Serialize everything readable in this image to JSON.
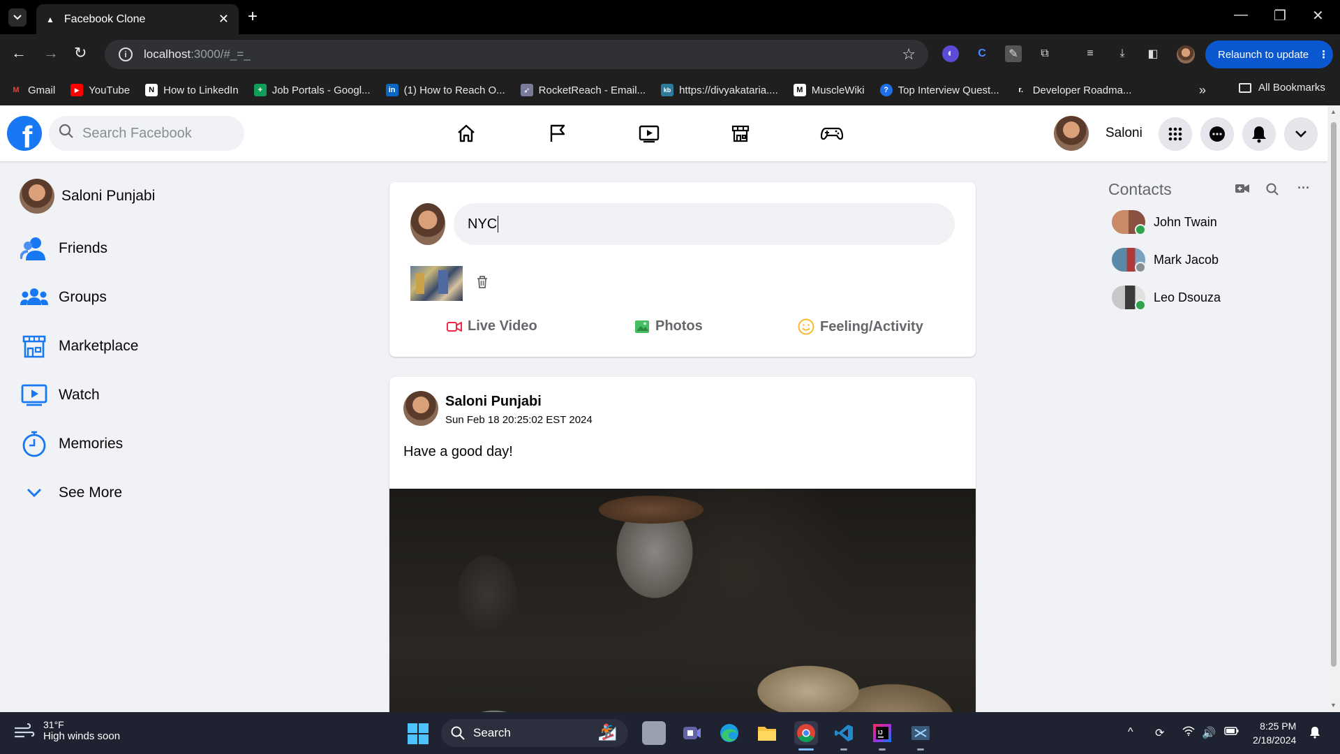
{
  "browser": {
    "tab_title": "Facebook Clone",
    "url_host": "localhost",
    "url_path": ":3000/#_=_",
    "relaunch_label": "Relaunch to update",
    "bookmarks": [
      {
        "label": "Gmail",
        "icon": "gmail-icon",
        "color": "#ea4335",
        "glyph": "M"
      },
      {
        "label": "YouTube",
        "icon": "youtube-icon",
        "color": "#ff0000",
        "glyph": "▶"
      },
      {
        "label": "How to LinkedIn",
        "icon": "notion-icon",
        "color": "#ffffff",
        "glyph": "N"
      },
      {
        "label": "Job Portals - Googl...",
        "icon": "sheets-icon",
        "color": "#0f9d58",
        "glyph": "+"
      },
      {
        "label": "(1) How to Reach O...",
        "icon": "linkedin-icon",
        "color": "#0a66c2",
        "glyph": "in"
      },
      {
        "label": "RocketReach - Email...",
        "icon": "rocket-icon",
        "color": "#7a7a9a",
        "glyph": "🚀"
      },
      {
        "label": "https://divyakataria....",
        "icon": "kb-icon",
        "color": "#2f7a9a",
        "glyph": "kb"
      },
      {
        "label": "MuscleWiki",
        "icon": "musclewiki-icon",
        "color": "#ffffff",
        "glyph": "M"
      },
      {
        "label": "Top Interview Quest...",
        "icon": "leetcode-icon",
        "color": "#1f6feb",
        "glyph": "?"
      },
      {
        "label": "Developer Roadma...",
        "icon": "roadmap-icon",
        "color": "#1f1f1f",
        "glyph": "r."
      }
    ],
    "all_bookmarks_label": "All Bookmarks"
  },
  "header": {
    "search_placeholder": "Search Facebook",
    "user_name": "Saloni",
    "brand_color": "#1877f2"
  },
  "sidebar": {
    "profile_name": "Saloni Punjabi",
    "items": [
      {
        "label": "Friends",
        "icon": "friends-icon"
      },
      {
        "label": "Groups",
        "icon": "groups-icon"
      },
      {
        "label": "Marketplace",
        "icon": "marketplace-icon"
      },
      {
        "label": "Watch",
        "icon": "watch-icon"
      },
      {
        "label": "Memories",
        "icon": "memories-icon"
      },
      {
        "label": "See More",
        "icon": "chevron-down-icon"
      }
    ]
  },
  "composer": {
    "input_value": "NYC",
    "actions": [
      {
        "label": "Live Video",
        "icon": "live-video-icon",
        "color": "#f02849"
      },
      {
        "label": "Photos",
        "icon": "photos-icon",
        "color": "#45bd62"
      },
      {
        "label": "Feeling/Activity",
        "icon": "feeling-icon",
        "color": "#f7b928"
      }
    ]
  },
  "post": {
    "author": "Saloni Punjabi",
    "timestamp": "Sun Feb 18 20:25:02 EST 2024",
    "text": "Have a good day!"
  },
  "contacts": {
    "title": "Contacts",
    "list": [
      {
        "name": "John Twain",
        "status": "online",
        "status_color": "#31a24c"
      },
      {
        "name": "Mark Jacob",
        "status": "offline",
        "status_color": "#8a8d91"
      },
      {
        "name": "Leo Dsouza",
        "status": "online",
        "status_color": "#31a24c"
      }
    ]
  },
  "taskbar": {
    "weather_temp": "31°F",
    "weather_desc": "High winds soon",
    "search_label": "Search",
    "time": "8:25 PM",
    "date": "2/18/2024"
  }
}
